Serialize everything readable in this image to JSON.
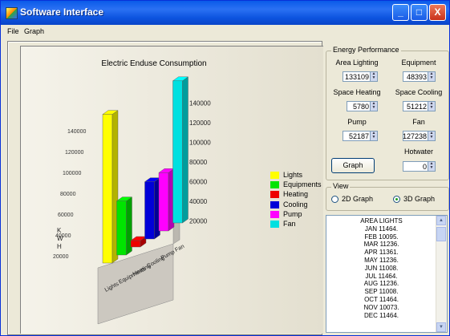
{
  "window": {
    "title": "Software Interface",
    "minimize": "_",
    "maximize": "□",
    "close": "X"
  },
  "menu": [
    "File",
    "Graph"
  ],
  "chart": {
    "title": "Electric Enduse Consumption",
    "y_axis_letters": [
      "K",
      "W",
      "H"
    ]
  },
  "chart_data": {
    "type": "bar",
    "title": "Electric Enduse Consumption",
    "ylabel": "KWH",
    "ylim": [
      0,
      140000
    ],
    "ytick_labels": [
      "20000",
      "40000",
      "60000",
      "80000",
      "100000",
      "120000",
      "140000"
    ],
    "categories": [
      "Lights",
      "Equipments",
      "Heating",
      "Cooling",
      "Pump",
      "Fan"
    ],
    "values": [
      133109,
      48393,
      5780,
      51212,
      52187,
      127238
    ],
    "colors": [
      "#ffff00",
      "#00e400",
      "#ee0000",
      "#0000d8",
      "#ff00ff",
      "#00e0e0"
    ]
  },
  "legend": [
    {
      "label": "Lights",
      "color": "#ffff00"
    },
    {
      "label": "Equipments",
      "color": "#00e400"
    },
    {
      "label": "Heating",
      "color": "#ee0000"
    },
    {
      "label": "Cooling",
      "color": "#0000d8"
    },
    {
      "label": "Pump",
      "color": "#ff00ff"
    },
    {
      "label": "Fan",
      "color": "#00e0e0"
    }
  ],
  "energy": {
    "group_title": "Energy Performance",
    "area_lighting_label": "Area Lighting",
    "area_lighting_value": "133109",
    "equipment_label": "Equipment",
    "equipment_value": "48393",
    "space_heating_label": "Space Heating",
    "space_heating_value": "5780",
    "space_cooling_label": "Space Cooling",
    "space_cooling_value": "51212",
    "pump_label": "Pump",
    "pump_value": "52187",
    "fan_label": "Fan",
    "fan_value": "127238",
    "hotwater_label": "Hotwater",
    "hotwater_value": "0",
    "graph_button": "Graph"
  },
  "view": {
    "group_title": "View",
    "option_2d": "2D Graph",
    "option_3d": "3D Graph",
    "selected": "3D Graph"
  },
  "list": {
    "lines": [
      "AREA LIGHTS",
      "JAN 11464.",
      "FEB 10095.",
      "MAR 11236.",
      "APR 11361.",
      "MAY 11236.",
      "JUN 11008.",
      "JUL 11464.",
      "AUG 11236.",
      "SEP 11008.",
      "OCT 11464.",
      "NOV 10073.",
      "DEC 11464."
    ]
  }
}
